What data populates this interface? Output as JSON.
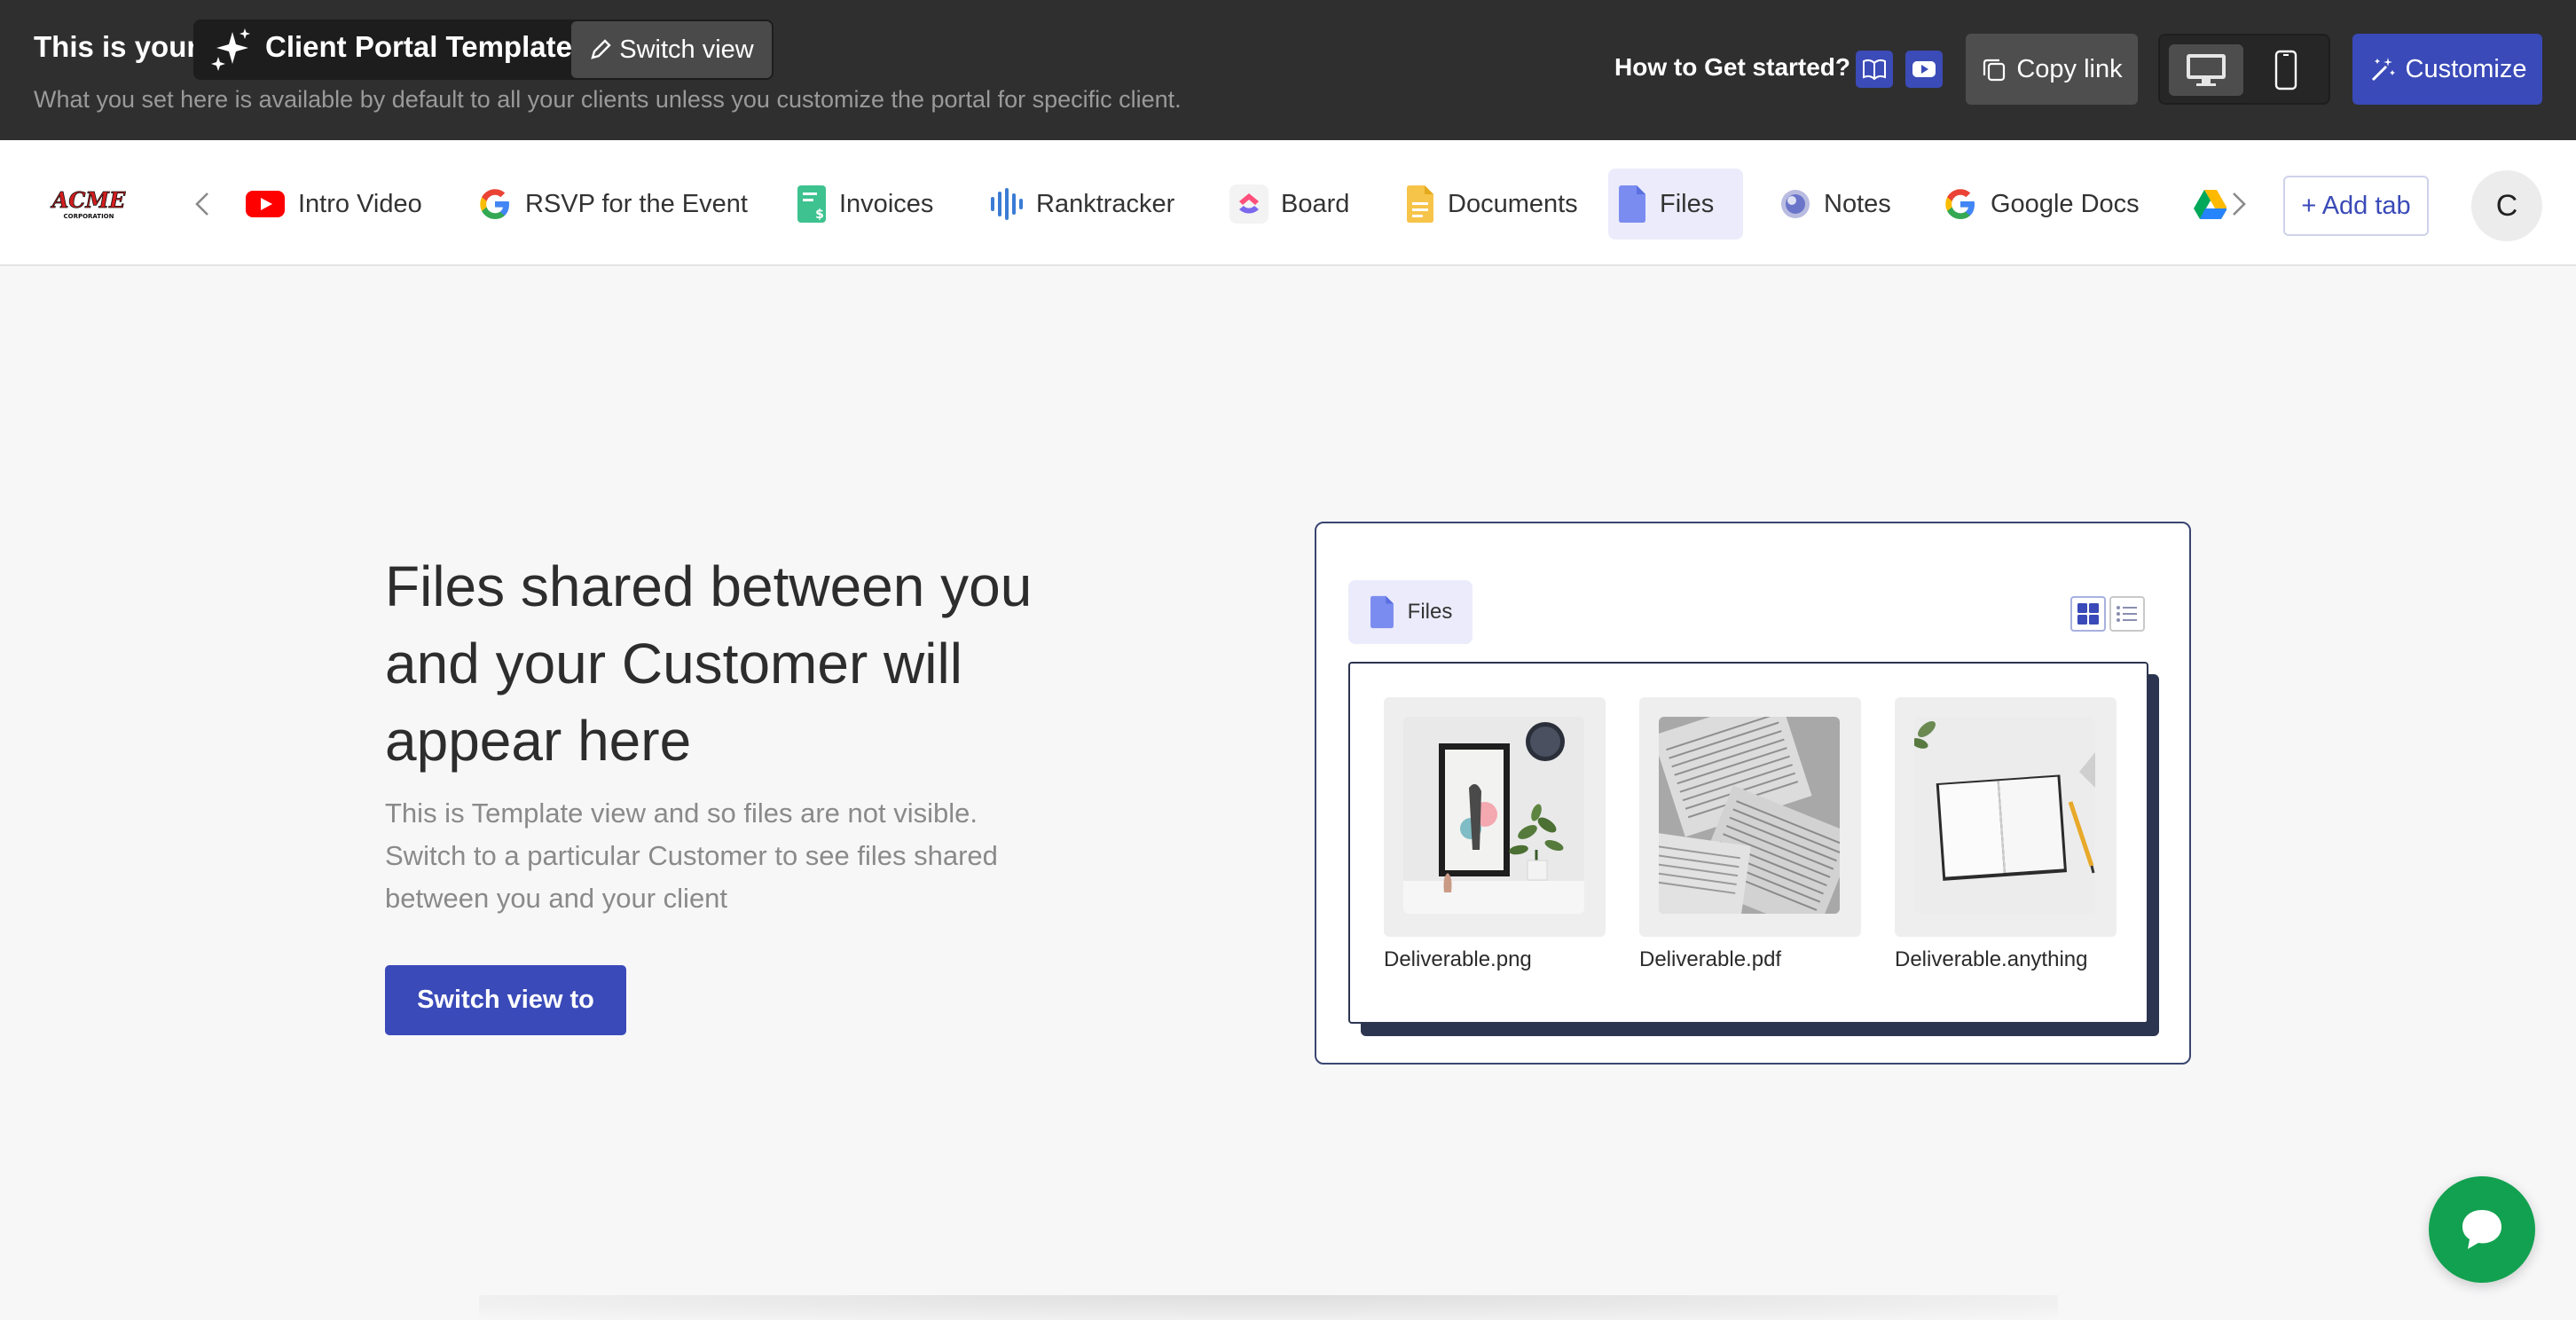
{
  "topbar": {
    "prefix": "This is your",
    "template_name": "Client Portal Template",
    "switch_view": "Switch view",
    "subtitle": "What you set here is available by default to all your clients unless you customize the portal for specific client.",
    "how_to": "How to Get started?",
    "copy_link": "Copy link",
    "customize": "Customize",
    "icons": [
      "sparkle-icon",
      "pencil-icon",
      "book-icon",
      "youtube-icon",
      "copy-icon",
      "desktop-icon",
      "mobile-icon",
      "magic-wand-icon"
    ]
  },
  "tabs": {
    "items": [
      {
        "label": "Intro Video",
        "icon": "youtube-icon"
      },
      {
        "label": "RSVP for the Event",
        "icon": "google-icon"
      },
      {
        "label": "Invoices",
        "icon": "invoice-icon"
      },
      {
        "label": "Ranktracker",
        "icon": "ranktracker-icon"
      },
      {
        "label": "Board",
        "icon": "clickup-icon"
      },
      {
        "label": "Documents",
        "icon": "document-icon"
      },
      {
        "label": "Files",
        "icon": "file-icon",
        "active": true
      },
      {
        "label": "Notes",
        "icon": "notes-icon"
      },
      {
        "label": "Google Docs",
        "icon": "google-icon"
      },
      {
        "label": "",
        "icon": "google-drive-icon"
      }
    ],
    "add_tab": "+ Add tab",
    "avatar_initial": "C"
  },
  "main": {
    "headline": "Files shared between you and your Customer will appear here",
    "description": "This is Template view and so files are not visible. Switch to a particular Customer to see files shared between you and your client",
    "cta": "Switch view to"
  },
  "illustration": {
    "tab_label": "Files",
    "files": [
      {
        "name": "Deliverable.png"
      },
      {
        "name": "Deliverable.pdf"
      },
      {
        "name": "Deliverable.anything"
      }
    ]
  },
  "colors": {
    "topbar_bg": "#2f2f2f",
    "accent": "#3a4ab8",
    "active_tab_bg": "#ebebfb",
    "chat": "#12a150"
  }
}
